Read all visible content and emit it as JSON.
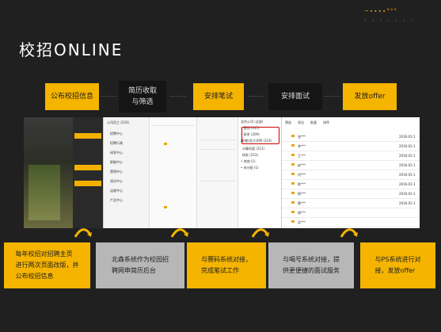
{
  "slide": {
    "title": "校招ONLINE",
    "brand": {
      "mark": "~∙∙∙∙°°°",
      "sub": "∙ ∙ ∙ ∙ ∙ ∙ ∙"
    }
  },
  "steps": [
    {
      "label": "公布校招信息",
      "style": "yellow"
    },
    {
      "label": "简历收取\n与筛选",
      "style": "dark"
    },
    {
      "label": "安排笔试",
      "style": "yellow"
    },
    {
      "label": "安排面试",
      "style": "dark"
    },
    {
      "label": "发放offer",
      "style": "yellow"
    }
  ],
  "screenshot": {
    "tree_items": [
      "北京公司 (全部)",
      "• 营销 (145)",
      "• 研发 (209)",
      "  (职能)北大学院 (214)",
      "计算机类 (213)",
      "研发 (213)",
      "• 其他 (1)",
      "• 未分配 (1)"
    ],
    "side_labels": [
      "公司员工 (234)",
      "招聘中心",
      "招聘行政",
      "研发中心",
      "职能中心",
      "营销中心",
      "测试中心",
      "运维中心",
      "产品中心"
    ],
    "grid_rows": [
      "张***",
      "李***",
      "王***",
      "赵***",
      "刘***",
      "陈***",
      "杨***",
      "黄***",
      "周***",
      "吴***"
    ],
    "grid_dates": [
      "2016-01-1",
      "2016-01-1",
      "2016-01-1",
      "2016-01-1",
      "2016-01-1",
      "2016-01-1",
      "2016-01-1",
      "2016-01-1"
    ],
    "toolbar": [
      "筛选",
      "导出",
      "批量",
      "排序"
    ]
  },
  "bottom_boxes": [
    {
      "label": "每年校招对招聘主页\n进行两次页面改版，并\n公布校招信息",
      "style": "yellow"
    },
    {
      "label": "北森系统作为校园招\n聘网申简历后台",
      "style": "grey"
    },
    {
      "label": "与赛码系统对接，\n完成笔试工作",
      "style": "yellow"
    },
    {
      "label": "与喝号系统对接，提\n供更便捷的面试服务",
      "style": "grey"
    },
    {
      "label": "与PS系统进行对\n接，发放offer",
      "style": "yellow"
    }
  ]
}
